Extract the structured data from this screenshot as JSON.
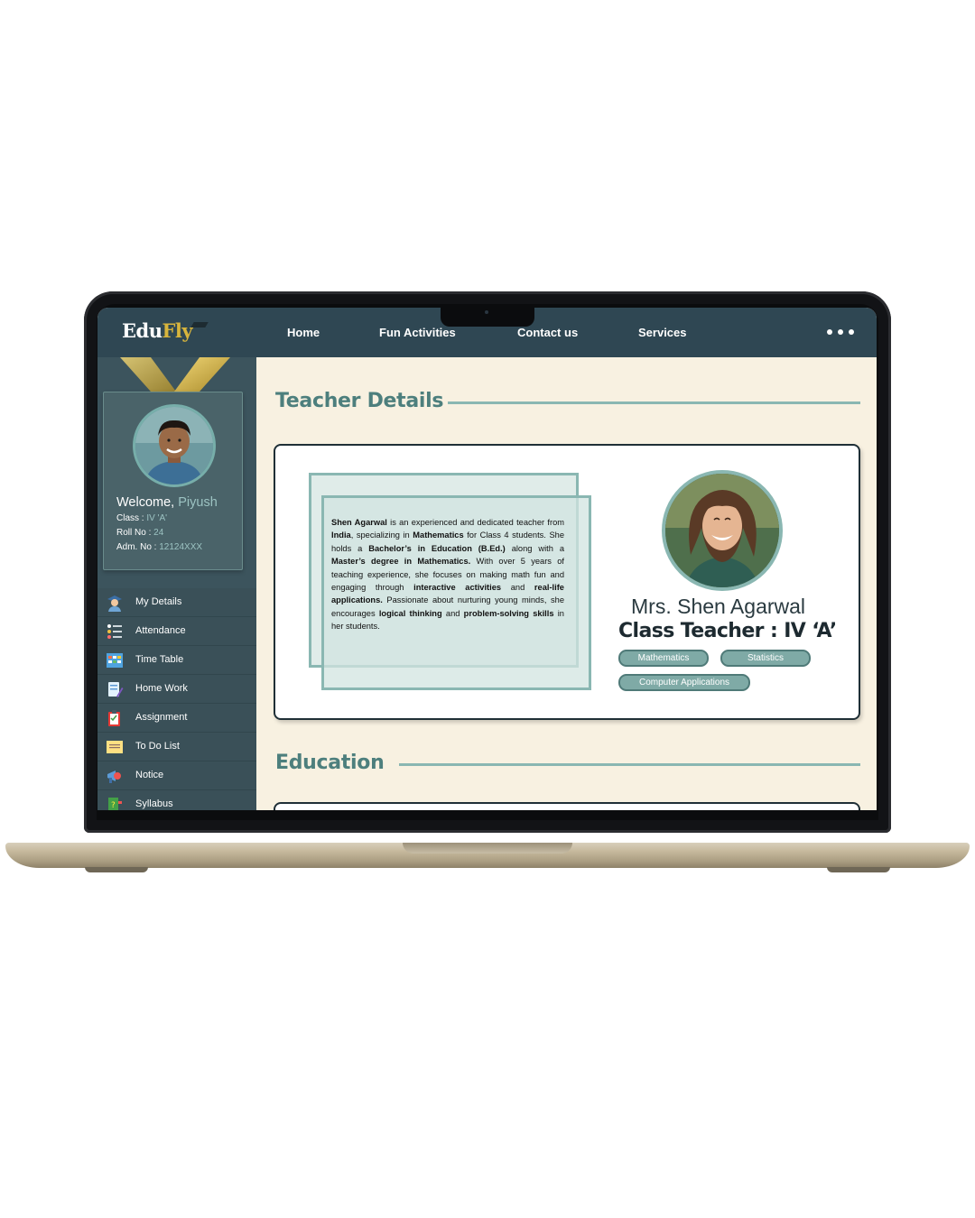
{
  "app": {
    "logo_part1": "Edu",
    "logo_part2": "Fly"
  },
  "nav": {
    "items": [
      "Home",
      "Fun Activities",
      "Contact us",
      "Services"
    ],
    "more_icon": "more-dots-icon"
  },
  "student": {
    "welcome_label": "Welcome,",
    "name": "Piyush",
    "class_label": "Class :",
    "class_value": "IV 'A'",
    "roll_label": "Roll No :",
    "roll_value": "24",
    "adm_label": "Adm. No :",
    "adm_value": "12124XXX"
  },
  "sidebar": {
    "items": [
      {
        "label": "My Details",
        "icon": "student-icon"
      },
      {
        "label": "Attendance",
        "icon": "checklist-icon"
      },
      {
        "label": "Time Table",
        "icon": "timetable-icon"
      },
      {
        "label": "Home Work",
        "icon": "homework-icon"
      },
      {
        "label": "Assignment",
        "icon": "clipboard-icon"
      },
      {
        "label": "To Do List",
        "icon": "todo-note-icon"
      },
      {
        "label": "Notice",
        "icon": "megaphone-icon"
      },
      {
        "label": "Syllabus",
        "icon": "book-icon"
      }
    ]
  },
  "teacher_section": {
    "title": "Teacher Details",
    "name": "Mrs. Shen Agarwal",
    "role": "Class Teacher : IV ‘A’",
    "subjects": [
      "Mathematics",
      "Statistics",
      "Computer Applications"
    ],
    "bio": {
      "p1": "Shen Agarwal",
      "p2": " is an experienced and dedicated teacher from ",
      "p3": "India",
      "p4": ", specializing in ",
      "p5": "Mathematics",
      "p6": " for Class 4 students. She holds a ",
      "p7": "Bachelor’s in Education (B.Ed.)",
      "p8": " along with a ",
      "p9": "Master’s degree in Mathematics.",
      "p10": " With over 5 years of teaching experience, she focuses on making math fun and engaging through ",
      "p11": "interactive activities",
      "p12": " and ",
      "p13": "real-life applications.",
      "p14": " Passionate about nurturing young minds, she encourages ",
      "p15": "logical thinking",
      "p16": " and ",
      "p17": "problem-solving skills",
      "p18": " in her students."
    }
  },
  "education_section": {
    "title": "Education"
  },
  "colors": {
    "topbar": "#2f4753",
    "sidebar": "#3c545d",
    "accent_teal": "#4d7f7d",
    "logo_gold": "#d8b53c",
    "background": "#f8f1e1"
  }
}
